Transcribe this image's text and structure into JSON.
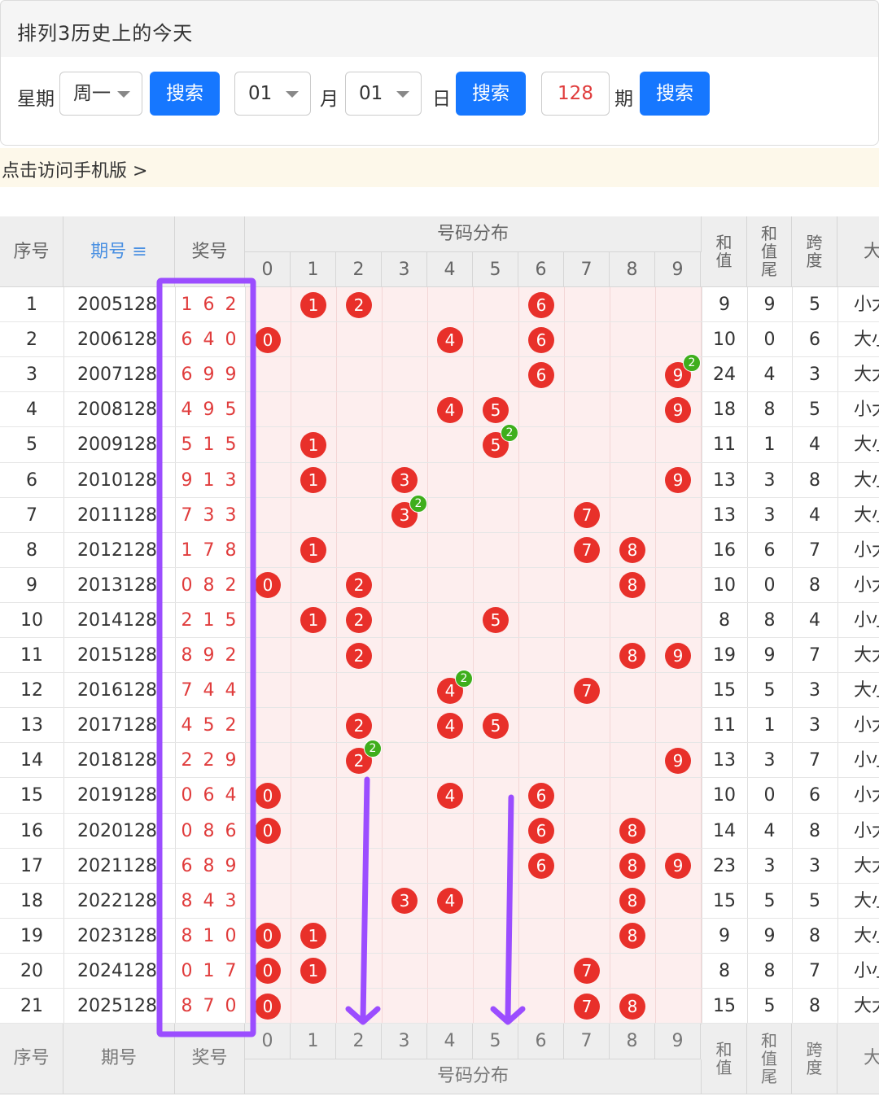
{
  "page_title": "排列3历史上的今天",
  "search": {
    "week_label": "星期",
    "week_value": "周一",
    "search_label": "搜索",
    "month_value": "01",
    "month_label": "月",
    "day_value": "01",
    "day_label": "日",
    "issue_value": "128",
    "issue_label": "期"
  },
  "notice": "点击访问手机版 >",
  "table": {
    "headers": {
      "index": "序号",
      "issue": "期号",
      "issue_sort_icon": "sort-icon",
      "prize": "奖号",
      "distribution": "号码分布",
      "sum": "和值",
      "sum_tail": "和值尾",
      "span": "跨度",
      "size": "大"
    },
    "digits": [
      "0",
      "1",
      "2",
      "3",
      "4",
      "5",
      "6",
      "7",
      "8",
      "9"
    ],
    "rows": [
      {
        "idx": "1",
        "issue": "2005128",
        "prize": "1 6 2",
        "nums": [
          1,
          6,
          2
        ],
        "sum": "9",
        "tail": "9",
        "span": "5",
        "size": "小大"
      },
      {
        "idx": "2",
        "issue": "2006128",
        "prize": "6 4 0",
        "nums": [
          6,
          4,
          0
        ],
        "sum": "10",
        "tail": "0",
        "span": "6",
        "size": "大小"
      },
      {
        "idx": "3",
        "issue": "2007128",
        "prize": "6 9 9",
        "nums": [
          6,
          9,
          9
        ],
        "sum": "24",
        "tail": "4",
        "span": "3",
        "size": "大大"
      },
      {
        "idx": "4",
        "issue": "2008128",
        "prize": "4 9 5",
        "nums": [
          4,
          9,
          5
        ],
        "sum": "18",
        "tail": "8",
        "span": "5",
        "size": "小大"
      },
      {
        "idx": "5",
        "issue": "2009128",
        "prize": "5 1 5",
        "nums": [
          5,
          1,
          5
        ],
        "sum": "11",
        "tail": "1",
        "span": "4",
        "size": "大小"
      },
      {
        "idx": "6",
        "issue": "2010128",
        "prize": "9 1 3",
        "nums": [
          9,
          1,
          3
        ],
        "sum": "13",
        "tail": "3",
        "span": "8",
        "size": "大小"
      },
      {
        "idx": "7",
        "issue": "2011128",
        "prize": "7 3 3",
        "nums": [
          7,
          3,
          3
        ],
        "sum": "13",
        "tail": "3",
        "span": "4",
        "size": "大小"
      },
      {
        "idx": "8",
        "issue": "2012128",
        "prize": "1 7 8",
        "nums": [
          1,
          7,
          8
        ],
        "sum": "16",
        "tail": "6",
        "span": "7",
        "size": "小大"
      },
      {
        "idx": "9",
        "issue": "2013128",
        "prize": "0 8 2",
        "nums": [
          0,
          8,
          2
        ],
        "sum": "10",
        "tail": "0",
        "span": "8",
        "size": "小大"
      },
      {
        "idx": "10",
        "issue": "2014128",
        "prize": "2 1 5",
        "nums": [
          2,
          1,
          5
        ],
        "sum": "8",
        "tail": "8",
        "span": "4",
        "size": "小小"
      },
      {
        "idx": "11",
        "issue": "2015128",
        "prize": "8 9 2",
        "nums": [
          8,
          9,
          2
        ],
        "sum": "19",
        "tail": "9",
        "span": "7",
        "size": "大大"
      },
      {
        "idx": "12",
        "issue": "2016128",
        "prize": "7 4 4",
        "nums": [
          7,
          4,
          4
        ],
        "sum": "15",
        "tail": "5",
        "span": "3",
        "size": "大小"
      },
      {
        "idx": "13",
        "issue": "2017128",
        "prize": "4 5 2",
        "nums": [
          4,
          5,
          2
        ],
        "sum": "11",
        "tail": "1",
        "span": "3",
        "size": "小大"
      },
      {
        "idx": "14",
        "issue": "2018128",
        "prize": "2 2 9",
        "nums": [
          2,
          2,
          9
        ],
        "sum": "13",
        "tail": "3",
        "span": "7",
        "size": "小小"
      },
      {
        "idx": "15",
        "issue": "2019128",
        "prize": "0 6 4",
        "nums": [
          0,
          6,
          4
        ],
        "sum": "10",
        "tail": "0",
        "span": "6",
        "size": "小大"
      },
      {
        "idx": "16",
        "issue": "2020128",
        "prize": "0 8 6",
        "nums": [
          0,
          8,
          6
        ],
        "sum": "14",
        "tail": "4",
        "span": "8",
        "size": "小大"
      },
      {
        "idx": "17",
        "issue": "2021128",
        "prize": "6 8 9",
        "nums": [
          6,
          8,
          9
        ],
        "sum": "23",
        "tail": "3",
        "span": "3",
        "size": "大大"
      },
      {
        "idx": "18",
        "issue": "2022128",
        "prize": "8 4 3",
        "nums": [
          8,
          4,
          3
        ],
        "sum": "15",
        "tail": "5",
        "span": "5",
        "size": "大小"
      },
      {
        "idx": "19",
        "issue": "2023128",
        "prize": "8 1 0",
        "nums": [
          8,
          1,
          0
        ],
        "sum": "9",
        "tail": "9",
        "span": "8",
        "size": "大小"
      },
      {
        "idx": "20",
        "issue": "2024128",
        "prize": "0 1 7",
        "nums": [
          0,
          1,
          7
        ],
        "sum": "8",
        "tail": "8",
        "span": "7",
        "size": "小小"
      },
      {
        "idx": "21",
        "issue": "2025128",
        "prize": "8 7 0",
        "nums": [
          8,
          7,
          0
        ],
        "sum": "15",
        "tail": "5",
        "span": "8",
        "size": "大大"
      }
    ]
  },
  "colors": {
    "ball": "#e8302a",
    "badge": "#3fae1c",
    "accent": "#1677ff",
    "annotation": "#9b4dff",
    "distribution_bg": "#fdeeee"
  }
}
